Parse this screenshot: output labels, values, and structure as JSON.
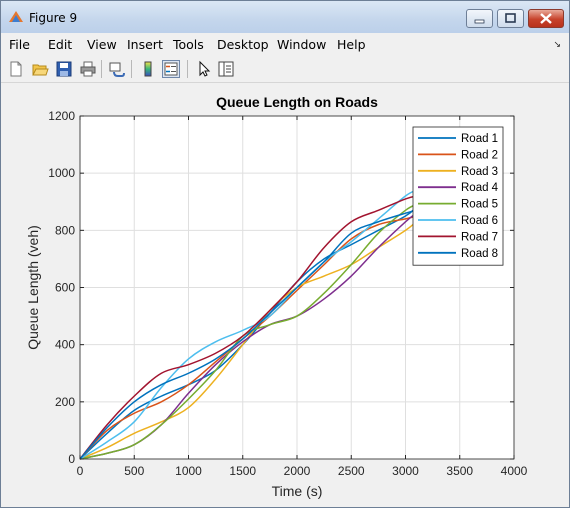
{
  "window": {
    "title": "Figure 9"
  },
  "menu": {
    "items": [
      "File",
      "Edit",
      "View",
      "Insert",
      "Tools",
      "Desktop",
      "Window",
      "Help"
    ]
  },
  "toolbar": {
    "icons": [
      "new-figure-icon",
      "open-icon",
      "save-icon",
      "print-icon",
      "link-plot-icon",
      "insert-colorbar-icon",
      "insert-legend-icon",
      "edit-plot-icon",
      "property-inspector-icon"
    ]
  },
  "colors": {
    "titlebar": "#c4d6ec",
    "series": [
      "#0072bd",
      "#d95319",
      "#edb120",
      "#7e2f8e",
      "#77ac30",
      "#4dbeee",
      "#a2142f",
      "#0072bd"
    ]
  },
  "chart_data": {
    "type": "line",
    "title": "Queue Length on Roads",
    "xlabel": "Time (s)",
    "ylabel": "Queue Length (veh)",
    "xlim": [
      0,
      4000
    ],
    "ylim": [
      0,
      1200
    ],
    "xticks": [
      "0",
      "500",
      "1000",
      "1500",
      "2000",
      "2500",
      "3000",
      "3500",
      "4000"
    ],
    "yticks": [
      "0",
      "200",
      "400",
      "600",
      "800",
      "1000",
      "1200"
    ],
    "grid": true,
    "legend_position": "top-right",
    "series": [
      {
        "name": "Road 1",
        "x": [
          0,
          250,
          500,
          750,
          1000,
          1250,
          1500,
          1750,
          2000,
          2250,
          2500,
          2750,
          3000,
          3100
        ],
        "y": [
          0,
          90,
          170,
          220,
          260,
          310,
          400,
          510,
          620,
          700,
          750,
          800,
          850,
          880
        ]
      },
      {
        "name": "Road 2",
        "x": [
          0,
          250,
          500,
          750,
          1000,
          1250,
          1500,
          1750,
          2000,
          2250,
          2500,
          2750,
          3000,
          3100
        ],
        "y": [
          0,
          100,
          160,
          200,
          260,
          340,
          420,
          500,
          590,
          680,
          770,
          820,
          840,
          850
        ]
      },
      {
        "name": "Road 3",
        "x": [
          0,
          250,
          500,
          750,
          1000,
          1250,
          1500,
          1750,
          2000,
          2250,
          2500,
          2750,
          3000,
          3100
        ],
        "y": [
          0,
          40,
          90,
          130,
          180,
          280,
          400,
          520,
          600,
          640,
          680,
          740,
          800,
          830
        ]
      },
      {
        "name": "Road 4",
        "x": [
          0,
          250,
          500,
          750,
          1000,
          1250,
          1500,
          1750,
          2000,
          2250,
          2500,
          2750,
          3000,
          3100
        ],
        "y": [
          0,
          20,
          50,
          120,
          230,
          330,
          410,
          470,
          500,
          560,
          640,
          740,
          830,
          860
        ]
      },
      {
        "name": "Road 5",
        "x": [
          0,
          250,
          500,
          750,
          1000,
          1250,
          1500,
          1750,
          2000,
          2250,
          2500,
          2750,
          3000,
          3100
        ],
        "y": [
          0,
          20,
          50,
          120,
          210,
          310,
          430,
          470,
          500,
          580,
          680,
          790,
          870,
          890
        ]
      },
      {
        "name": "Road 6",
        "x": [
          0,
          250,
          500,
          750,
          1000,
          1250,
          1500,
          1750,
          2000,
          2250,
          2500,
          2750,
          3000,
          3100
        ],
        "y": [
          0,
          60,
          130,
          250,
          350,
          410,
          450,
          500,
          600,
          690,
          760,
          840,
          920,
          940
        ]
      },
      {
        "name": "Road 7",
        "x": [
          0,
          250,
          500,
          750,
          1000,
          1250,
          1500,
          1750,
          2000,
          2250,
          2500,
          2750,
          3000,
          3100
        ],
        "y": [
          0,
          120,
          220,
          300,
          330,
          370,
          430,
          520,
          620,
          740,
          830,
          870,
          910,
          920
        ]
      },
      {
        "name": "Road 8",
        "x": [
          0,
          250,
          500,
          750,
          1000,
          1250,
          1500,
          1750,
          2000,
          2250,
          2500,
          2750,
          3000,
          3100
        ],
        "y": [
          0,
          110,
          200,
          260,
          300,
          350,
          420,
          510,
          600,
          690,
          790,
          830,
          860,
          870
        ]
      }
    ]
  }
}
